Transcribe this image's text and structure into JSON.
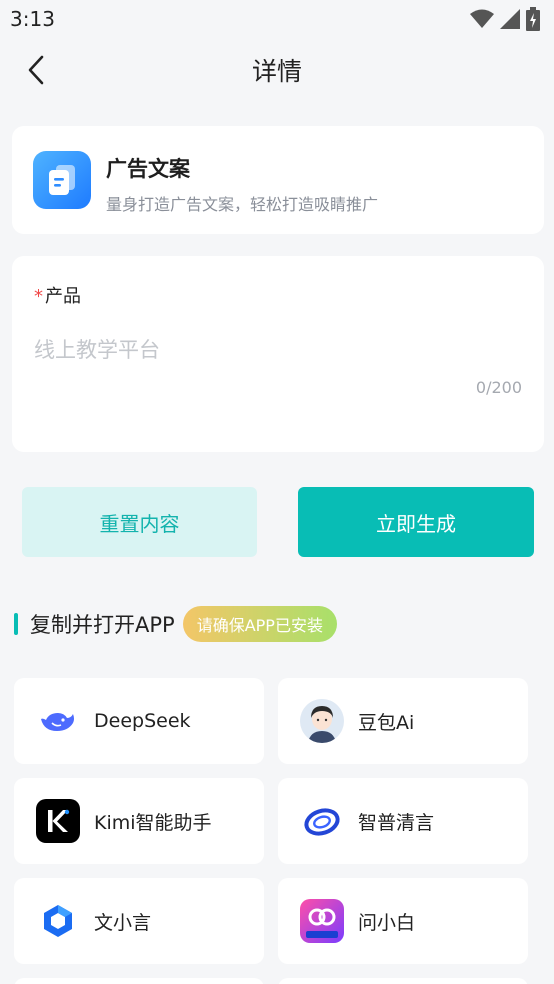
{
  "status": {
    "time": "3:13"
  },
  "nav": {
    "title": "详情"
  },
  "feature": {
    "title": "广告文案",
    "desc": "量身打造广告文案，轻松打造吸睛推广"
  },
  "form": {
    "label": "产品",
    "required_mark": "*",
    "placeholder": "线上教学平台",
    "value": "",
    "counter": "0/200"
  },
  "actions": {
    "reset_label": "重置内容",
    "generate_label": "立即生成"
  },
  "apps_section": {
    "title": "复制并打开APP",
    "badge": "请确保APP已安装",
    "apps": [
      {
        "name": "DeepSeek",
        "icon": "deepseek-whale-icon"
      },
      {
        "name": "豆包Ai",
        "icon": "doubao-avatar-icon"
      },
      {
        "name": "Kimi智能助手",
        "icon": "kimi-k-icon"
      },
      {
        "name": "智普清言",
        "icon": "zhipu-ring-icon"
      },
      {
        "name": "文小言",
        "icon": "wenxiaoyan-cube-icon"
      },
      {
        "name": "问小白",
        "icon": "wenxiaobai-badge-icon"
      }
    ]
  },
  "colors": {
    "accent": "#08bdb5",
    "accent_light": "#d9f4f3",
    "required": "#f04848"
  }
}
